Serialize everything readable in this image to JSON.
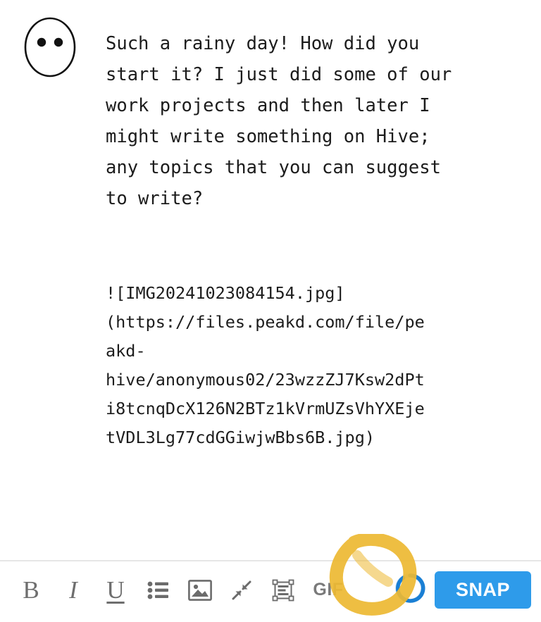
{
  "composer": {
    "avatar": {
      "icon": "face-two-dots-avatar-icon"
    },
    "message_lines": [
      "Such a rainy day! How did you",
      "start it? I just did some of our",
      "work projects and then later I",
      "might write something on Hive;",
      "any topics that you can suggest",
      "to write?"
    ],
    "message_text": "Such a rainy day! How did you start it? I just did some of our work projects and then later I might write something on Hive; any topics that you can suggest to write?",
    "link_lines": [
      "![IMG20241023084154.jpg]",
      "(https://files.peakd.com/file/pe",
      "akd-",
      "hive/anonymous02/23wzzZJ7Ksw2dPt",
      "i8tcnqDcX126N2BTz1kVrmUZsVhYXEje",
      "tVDL3Lg77cdGGiwjwBbs6B.jpg)"
    ],
    "link_text": "![IMG20241023084154.jpg](https://files.peakd.com/file/peakd-hive/anonymous02/23wzzZJ7Ksw2dPti8tcnqDcX126N2BTz1kVrmUZsVhYXEjetVDL3Lg77cdGGiwjwBbs6B.jpg)",
    "text_color": "#1c1c1c"
  },
  "toolbar": {
    "bold_label": "B",
    "italic_label": "I",
    "underline_label": "U",
    "list_icon": "bulleted-list-icon",
    "image_icon": "image-icon",
    "compress_icon": "compress-arrows-icon",
    "text_frame_icon": "text-frame-resize-icon",
    "gif_label": "GIF",
    "spinner_icon": "loading-spinner-icon",
    "submit_label": "SNAP",
    "accent_color": "#2e9bea",
    "icon_color": "#6b6b6b",
    "divider_color": "#e6e6e6"
  },
  "annotation": {
    "shape": "hand-drawn-circle-highlight",
    "color": "#edb832"
  }
}
